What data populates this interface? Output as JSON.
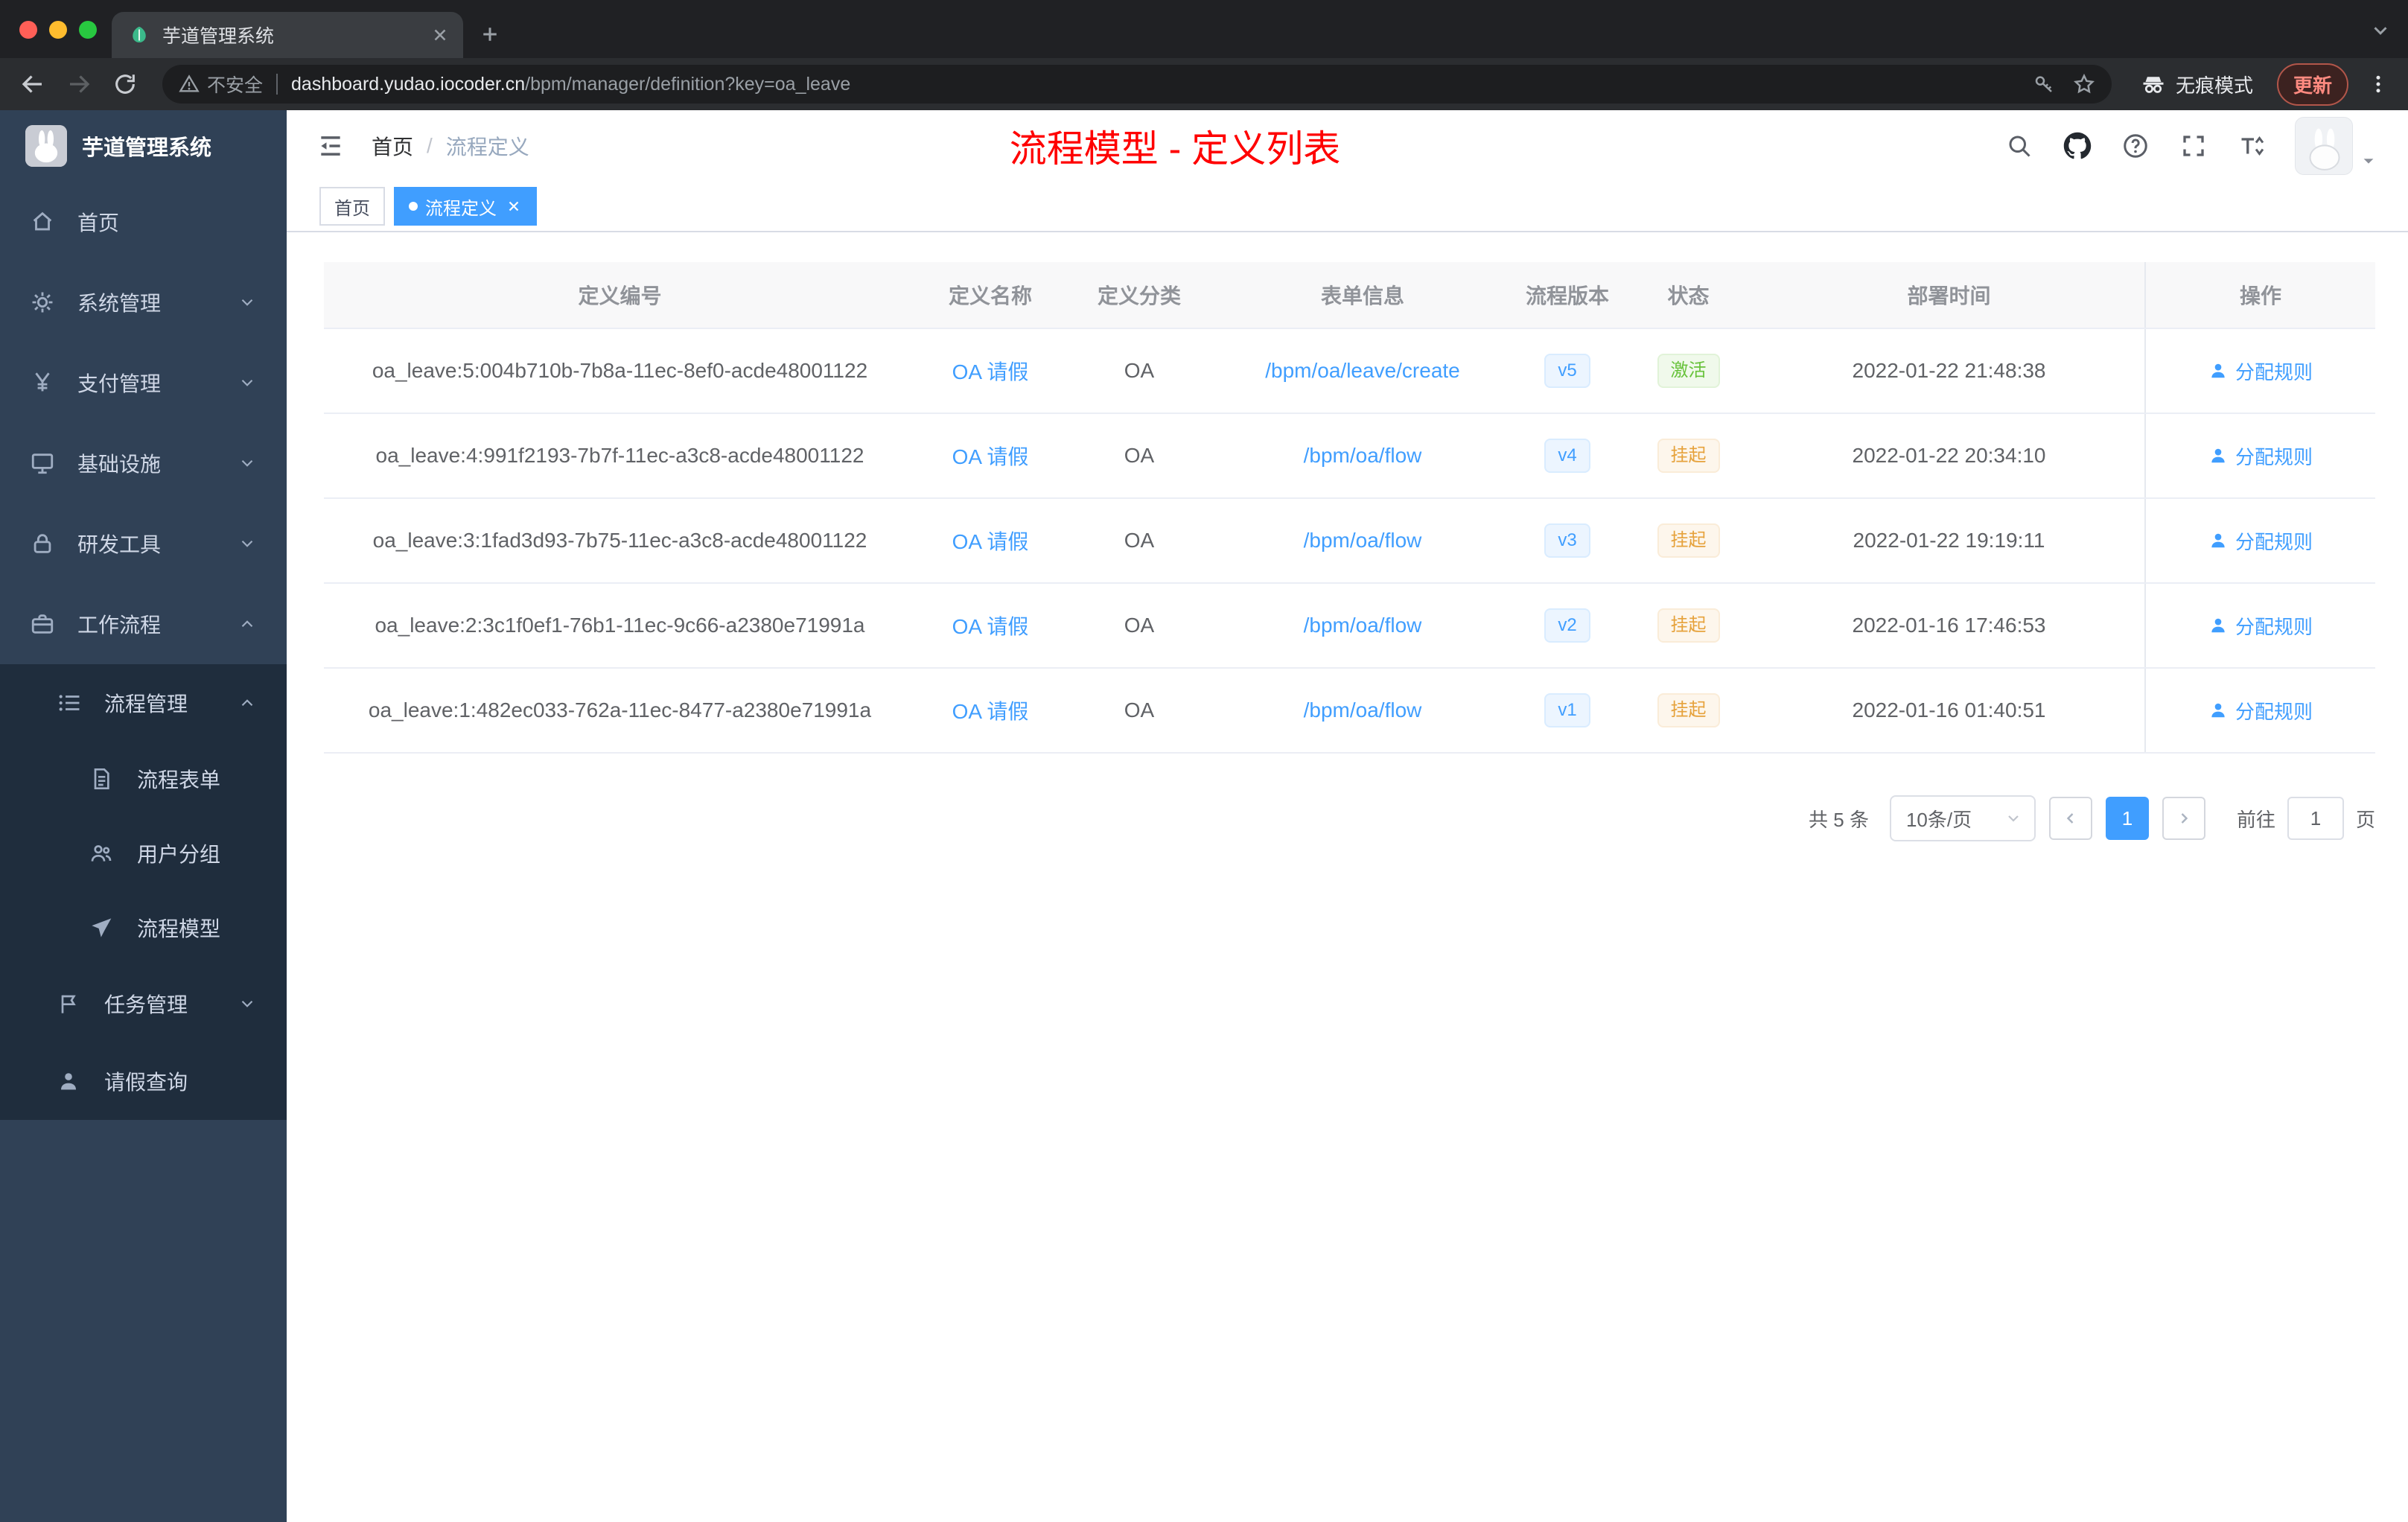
{
  "colors": {
    "primary": "#409eff",
    "success": "#67c23a",
    "warning": "#e6a23c",
    "annotation": "#ff0000",
    "sidebar_bg": "#304156",
    "submenu_bg": "#1f2d3d"
  },
  "browser": {
    "tab_title": "芋道管理系统",
    "security_label": "不安全",
    "url_host": "dashboard.yudao.iocoder.cn",
    "url_path": "/bpm/manager/definition?key=oa_leave",
    "incognito_label": "无痕模式",
    "update_label": "更新"
  },
  "sidebar": {
    "app_title": "芋道管理系统",
    "items": [
      {
        "label": "首页"
      },
      {
        "label": "系统管理"
      },
      {
        "label": "支付管理"
      },
      {
        "label": "基础设施"
      },
      {
        "label": "研发工具"
      },
      {
        "label": "工作流程"
      },
      {
        "label": "流程管理"
      },
      {
        "label": "流程表单"
      },
      {
        "label": "用户分组"
      },
      {
        "label": "流程模型"
      },
      {
        "label": "任务管理"
      },
      {
        "label": "请假查询"
      }
    ]
  },
  "header": {
    "breadcrumb_home": "首页",
    "breadcrumb_sep": "/",
    "breadcrumb_current": "流程定义",
    "annotation": "流程模型 - 定义列表"
  },
  "tags": {
    "home": "首页",
    "active": "流程定义"
  },
  "table": {
    "columns": [
      "定义编号",
      "定义名称",
      "定义分类",
      "表单信息",
      "流程版本",
      "状态",
      "部署时间",
      "操作"
    ],
    "rows": [
      {
        "id": "oa_leave:5:004b710b-7b8a-11ec-8ef0-acde48001122",
        "name": "OA 请假",
        "category": "OA",
        "form": "/bpm/oa/leave/create",
        "version": "v5",
        "status": "激活",
        "time": "2022-01-22 21:48:38",
        "action": "分配规则"
      },
      {
        "id": "oa_leave:4:991f2193-7b7f-11ec-a3c8-acde48001122",
        "name": "OA 请假",
        "category": "OA",
        "form": "/bpm/oa/flow",
        "version": "v4",
        "status": "挂起",
        "time": "2022-01-22 20:34:10",
        "action": "分配规则"
      },
      {
        "id": "oa_leave:3:1fad3d93-7b75-11ec-a3c8-acde48001122",
        "name": "OA 请假",
        "category": "OA",
        "form": "/bpm/oa/flow",
        "version": "v3",
        "status": "挂起",
        "time": "2022-01-22 19:19:11",
        "action": "分配规则"
      },
      {
        "id": "oa_leave:2:3c1f0ef1-76b1-11ec-9c66-a2380e71991a",
        "name": "OA 请假",
        "category": "OA",
        "form": "/bpm/oa/flow",
        "version": "v2",
        "status": "挂起",
        "time": "2022-01-16 17:46:53",
        "action": "分配规则"
      },
      {
        "id": "oa_leave:1:482ec033-762a-11ec-8477-a2380e71991a",
        "name": "OA 请假",
        "category": "OA",
        "form": "/bpm/oa/flow",
        "version": "v1",
        "status": "挂起",
        "time": "2022-01-16 01:40:51",
        "action": "分配规则"
      }
    ]
  },
  "pagination": {
    "total": "共 5 条",
    "page_size": "10条/页",
    "current_page": "1",
    "goto_label": "前往",
    "goto_value": "1",
    "goto_unit": "页"
  }
}
